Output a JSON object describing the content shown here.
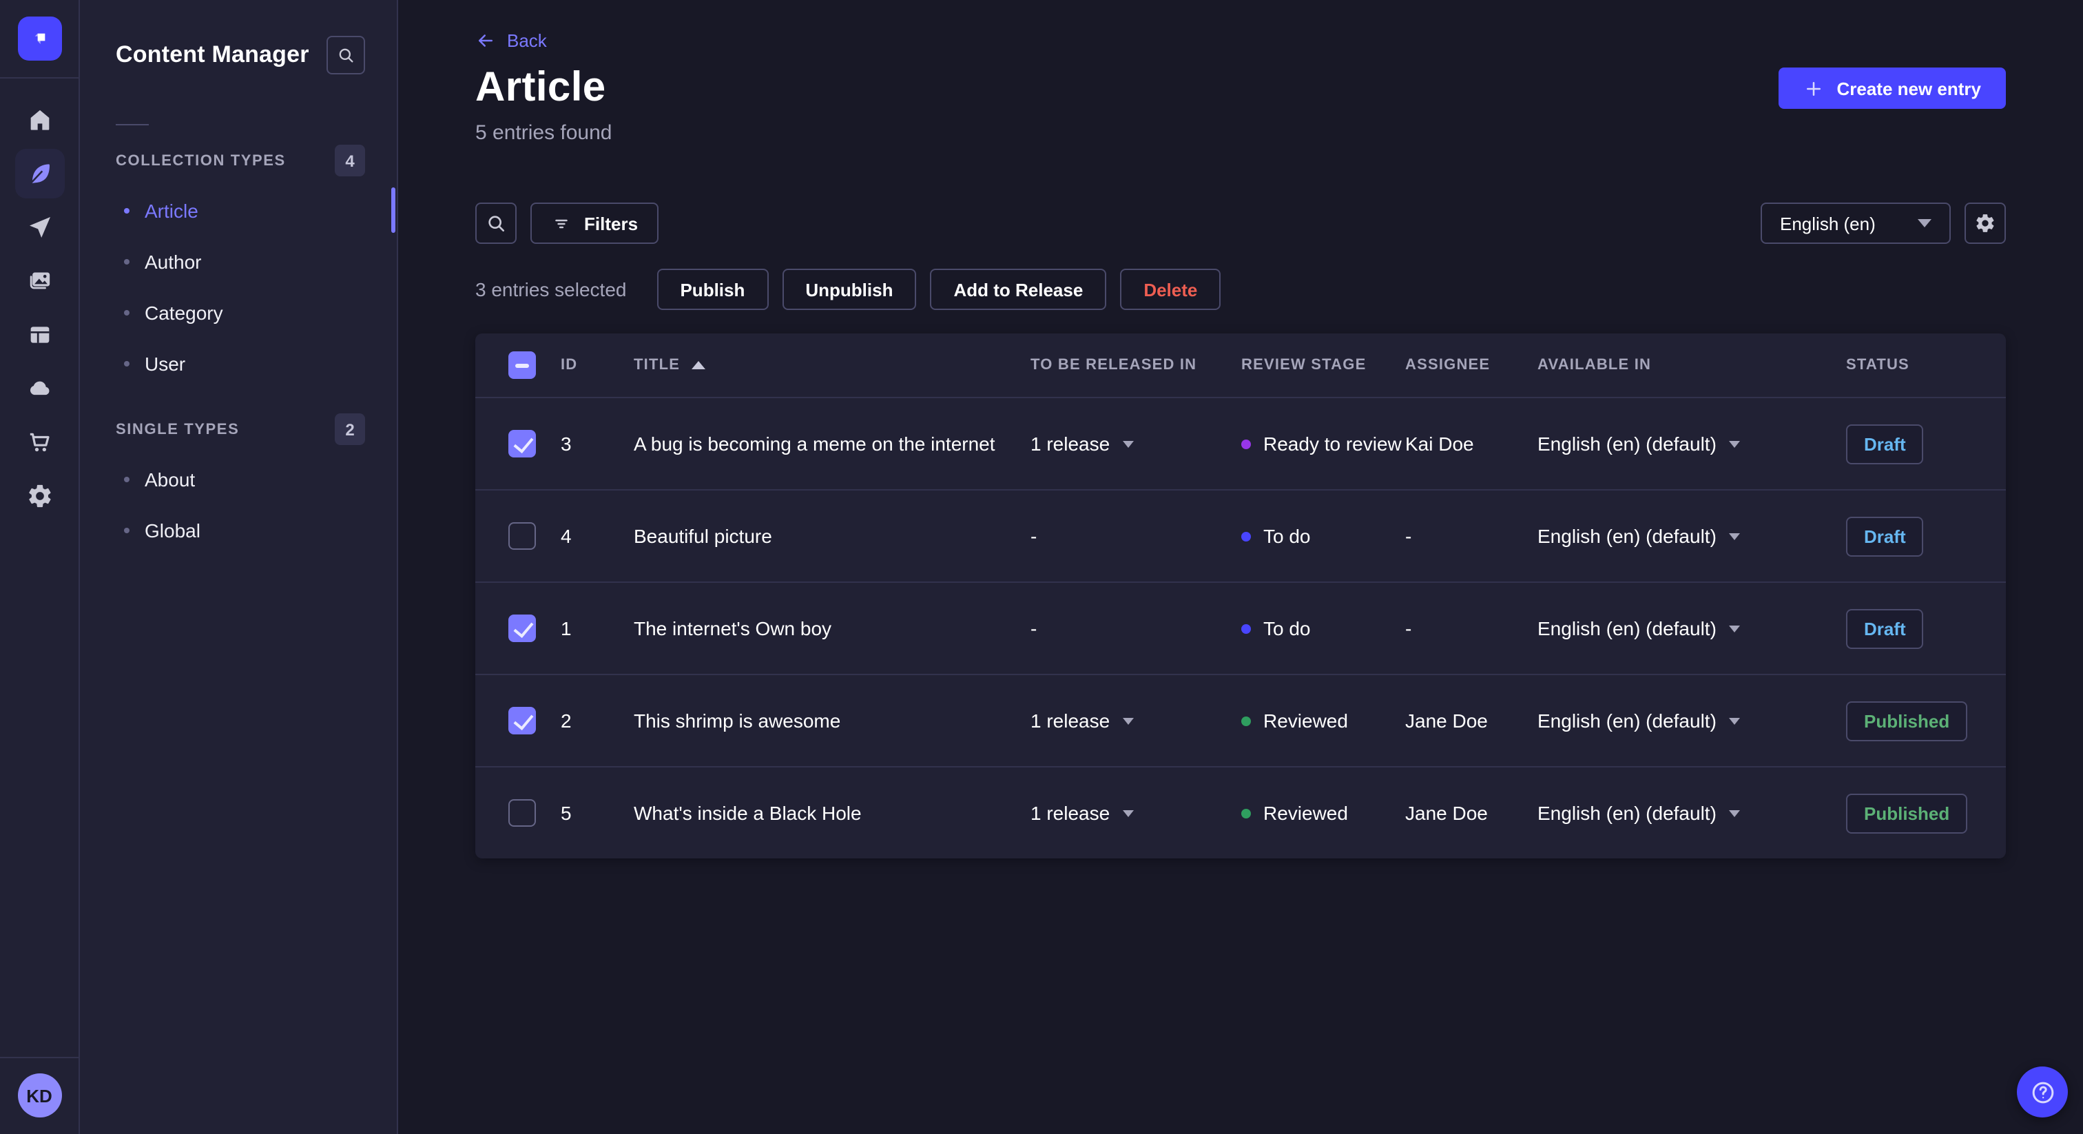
{
  "nav_rail": {
    "icons": [
      "home",
      "content-manager",
      "releases",
      "media-library",
      "content-type-builder",
      "cloud",
      "marketplace",
      "settings"
    ],
    "active_icon": "content-manager",
    "avatar_initials": "KD"
  },
  "content_sidebar": {
    "title": "Content Manager",
    "sections": [
      {
        "label": "COLLECTION TYPES",
        "count": "4",
        "items": [
          {
            "label": "Article",
            "active": "true"
          },
          {
            "label": "Author",
            "active": "false"
          },
          {
            "label": "Category",
            "active": "false"
          },
          {
            "label": "User",
            "active": "false"
          }
        ]
      },
      {
        "label": "SINGLE TYPES",
        "count": "2",
        "items": [
          {
            "label": "About",
            "active": "false"
          },
          {
            "label": "Global",
            "active": "false"
          }
        ]
      }
    ]
  },
  "header": {
    "back_label": "Back",
    "title": "Article",
    "subtitle": "5 entries found",
    "create_button_label": "Create new entry"
  },
  "toolbar": {
    "filters_label": "Filters",
    "locale_value": "English (en)"
  },
  "selection_bar": {
    "summary": "3 entries selected",
    "actions": [
      {
        "label": "Publish",
        "variant": "default"
      },
      {
        "label": "Unpublish",
        "variant": "default"
      },
      {
        "label": "Add to Release",
        "variant": "default"
      },
      {
        "label": "Delete",
        "variant": "danger"
      }
    ]
  },
  "table": {
    "select_all_state": "indeterminate",
    "headers": [
      "ID",
      "TITLE",
      "TO BE RELEASED IN",
      "REVIEW STAGE",
      "ASSIGNEE",
      "AVAILABLE IN",
      "STATUS"
    ],
    "sort": {
      "column": "TITLE",
      "direction": "ascending"
    },
    "rows": [
      {
        "checkbox": "checked",
        "id": "3",
        "title": "A bug is becoming a meme on the internet",
        "released_in": "1 release",
        "has_release_menu": "true",
        "review_stage": "Ready to review",
        "stage_kind": "ready",
        "assignee": "Kai Doe",
        "available_in": "English (en) (default)",
        "status": "Draft",
        "status_kind": "draft"
      },
      {
        "checkbox": "unchecked",
        "id": "4",
        "title": "Beautiful picture",
        "released_in": "-",
        "has_release_menu": "false",
        "review_stage": "To do",
        "stage_kind": "todo",
        "assignee": "-",
        "available_in": "English (en) (default)",
        "status": "Draft",
        "status_kind": "draft"
      },
      {
        "checkbox": "checked",
        "id": "1",
        "title": "The internet's Own boy",
        "released_in": "-",
        "has_release_menu": "false",
        "review_stage": "To do",
        "stage_kind": "todo",
        "assignee": "-",
        "available_in": "English (en) (default)",
        "status": "Draft",
        "status_kind": "draft"
      },
      {
        "checkbox": "checked",
        "id": "2",
        "title": "This shrimp is awesome",
        "released_in": "1 release",
        "has_release_menu": "true",
        "review_stage": "Reviewed",
        "stage_kind": "reviewed",
        "assignee": "Jane Doe",
        "available_in": "English (en) (default)",
        "status": "Published",
        "status_kind": "published"
      },
      {
        "checkbox": "unchecked",
        "id": "5",
        "title": "What's inside a Black Hole",
        "released_in": "1 release",
        "has_release_menu": "true",
        "review_stage": "Reviewed",
        "stage_kind": "reviewed",
        "assignee": "Jane Doe",
        "available_in": "English (en) (default)",
        "status": "Published",
        "status_kind": "published"
      }
    ]
  },
  "colors": {
    "background": "#181826",
    "surface": "#212134",
    "primary": "#4945ff",
    "primary_light": "#7b79ff",
    "danger": "#ee5e52",
    "status_draft": "#66b7f1",
    "status_published": "#5cb176",
    "stage_ready_to_review": "#9736e8",
    "stage_to_do": "#4945ff",
    "stage_reviewed": "#2f9e5f",
    "text_muted": "#a5a5ba",
    "border": "#32324d",
    "border_strong": "#4a4a6a"
  }
}
